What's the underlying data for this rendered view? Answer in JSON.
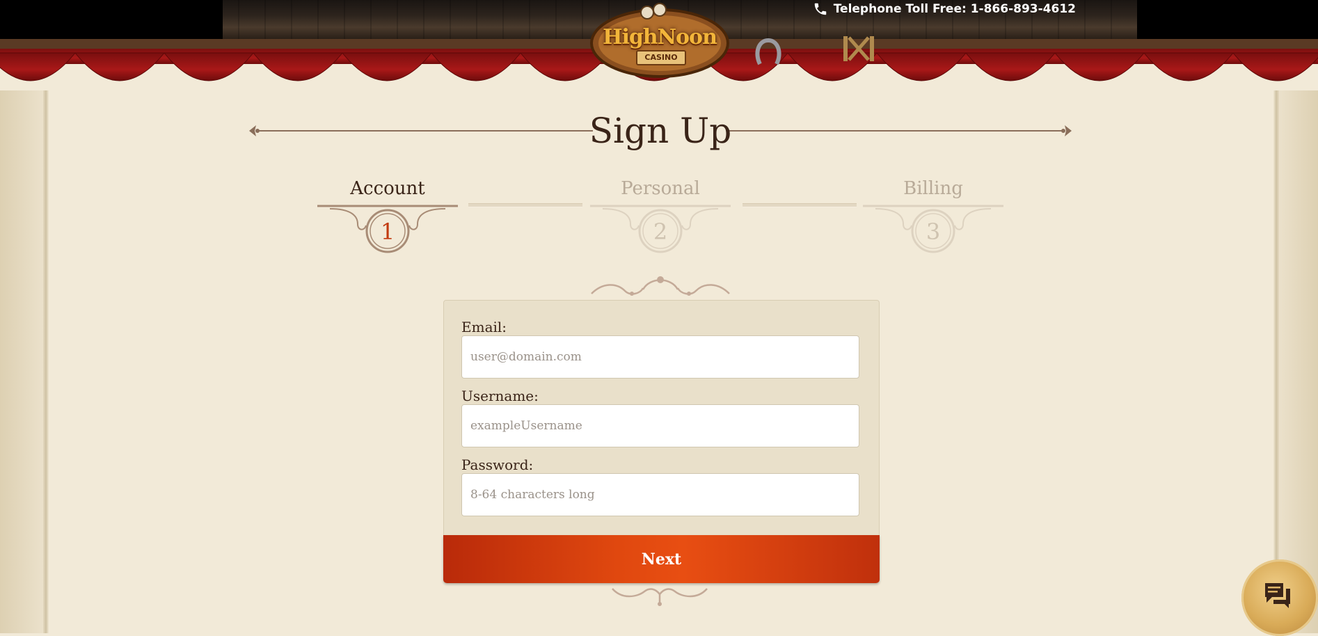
{
  "header": {
    "phone_label": "Telephone Toll Free: 1-866-893-4612",
    "logo_text": "HighNoon",
    "logo_sub": "CASINO"
  },
  "page": {
    "title": "Sign Up"
  },
  "steps": [
    {
      "label": "Account",
      "number": "1",
      "active": true
    },
    {
      "label": "Personal",
      "number": "2",
      "active": false
    },
    {
      "label": "Billing",
      "number": "3",
      "active": false
    }
  ],
  "form": {
    "email_label": "Email:",
    "email_placeholder": "user@domain.com",
    "username_label": "Username:",
    "username_placeholder": "exampleUsername",
    "password_label": "Password:",
    "password_placeholder": "8-64 characters long",
    "next_label": "Next"
  },
  "colors": {
    "accent": "#e0480f",
    "active_step": "#3a2418",
    "inactive_step": "#b8aa98",
    "step_number_active": "#c23a10"
  },
  "icons": {
    "phone": "phone-icon",
    "chat": "chat-icon"
  }
}
